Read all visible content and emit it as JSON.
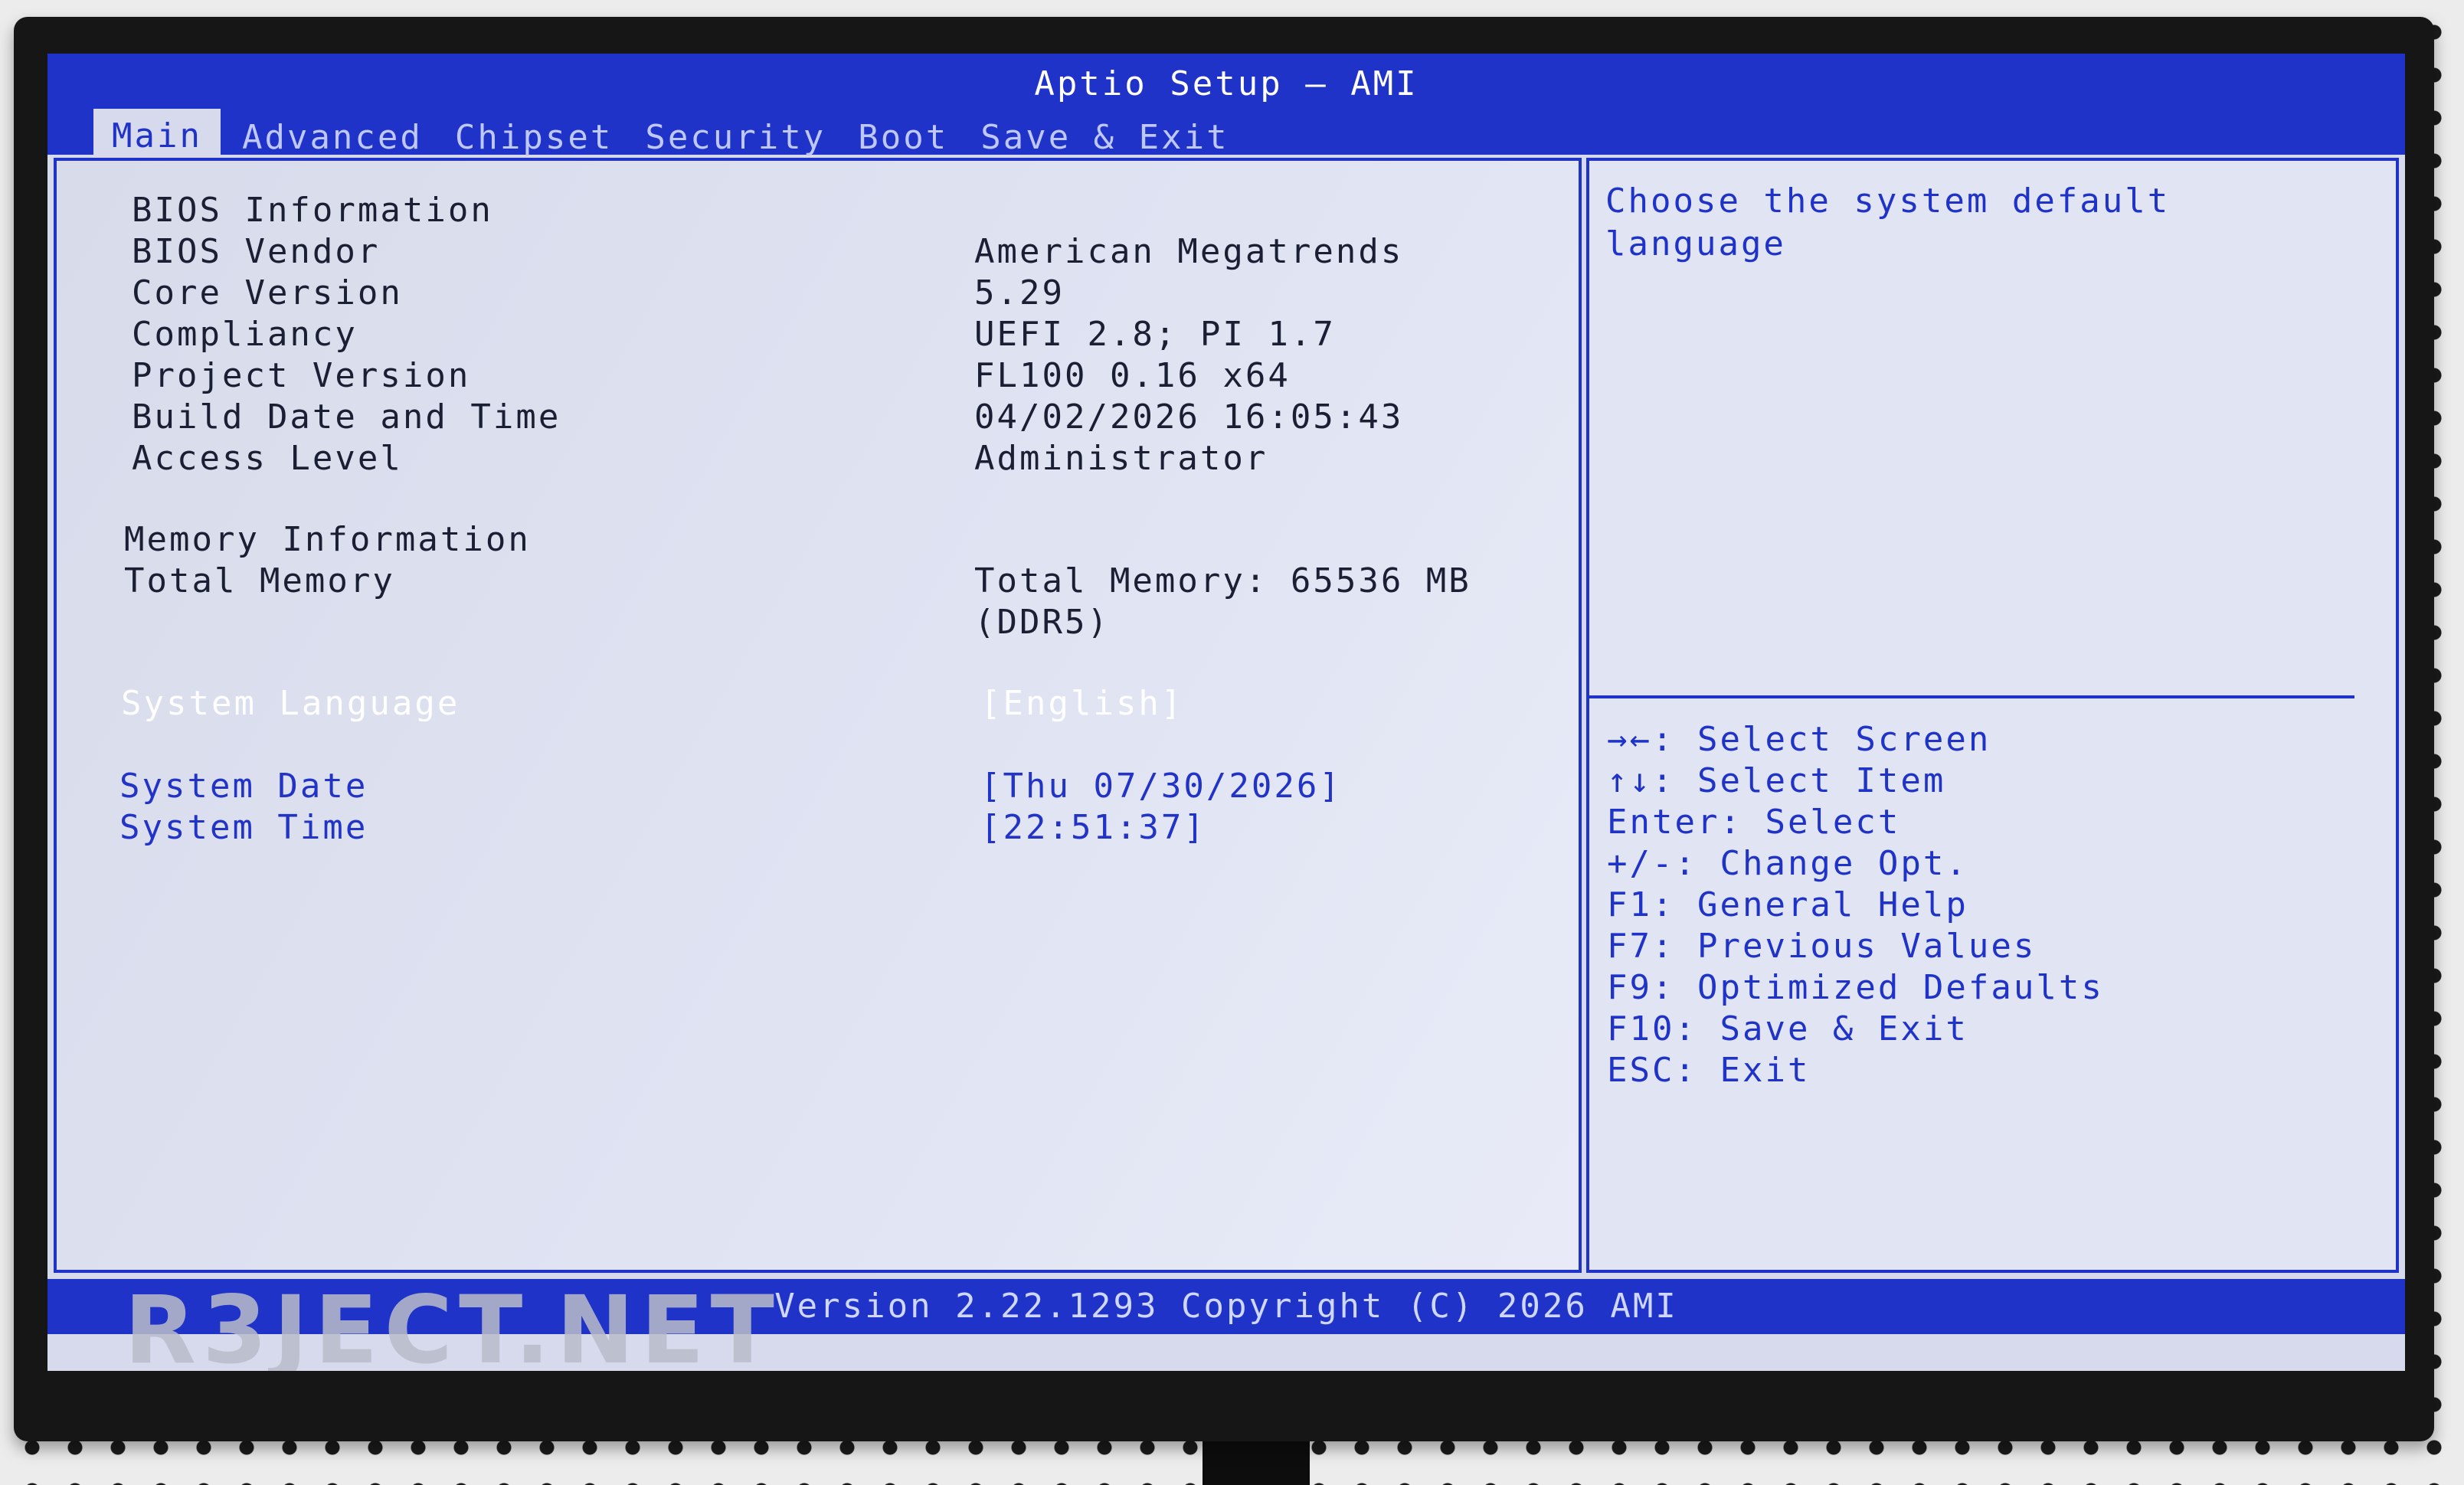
{
  "app": {
    "title": "Aptio Setup – AMI",
    "tabs": [
      {
        "label": "Main"
      },
      {
        "label": "Advanced"
      },
      {
        "label": "Chipset"
      },
      {
        "label": "Security"
      },
      {
        "label": "Boot"
      },
      {
        "label": "Save & Exit"
      }
    ],
    "active_tab": "Main",
    "accent_color": "#1f33c8"
  },
  "main": {
    "bios_info": {
      "header": "BIOS Information",
      "vendor_label": "BIOS Vendor",
      "vendor_value": "American Megatrends",
      "core_label": "Core Version",
      "core_value": "5.29",
      "compliancy_label": "Compliancy",
      "compliancy_value": "UEFI 2.8; PI 1.7",
      "project_label": "Project Version",
      "project_value": "FL100 0.16 x64",
      "build_label": "Build Date and Time",
      "build_value": "04/02/2026 16:05:43",
      "access_label": "Access Level",
      "access_value": "Administrator"
    },
    "memory": {
      "header": "Memory Information",
      "total_label": "Total Memory",
      "total_value_line1": "Total Memory: 65536 MB",
      "total_value_line2": "(DDR5)"
    },
    "language": {
      "label": "System Language",
      "value": "[English]"
    },
    "date": {
      "label": "System Date",
      "value": "[Thu 07/30/2026]"
    },
    "time": {
      "label": "System Time",
      "value": "[22:51:37]"
    }
  },
  "help": {
    "line1": "Choose the system default",
    "line2": "language",
    "keys": [
      {
        "key": "→←:",
        "desc": "Select Screen"
      },
      {
        "key": "↑↓:",
        "desc": "Select Item"
      },
      {
        "key": "Enter:",
        "desc": "Select"
      },
      {
        "key": "+/-:",
        "desc": "Change Opt."
      },
      {
        "key": "F1:",
        "desc": "General Help"
      },
      {
        "key": "F7:",
        "desc": "Previous Values"
      },
      {
        "key": "F9:",
        "desc": "Optimized Defaults"
      },
      {
        "key": "F10:",
        "desc": "Save & Exit"
      },
      {
        "key": "ESC:",
        "desc": "Exit"
      }
    ]
  },
  "footer": {
    "text": "Version 2.22.1293 Copyright (C) 2026 AMI"
  },
  "watermark": "R3JECT.NET"
}
